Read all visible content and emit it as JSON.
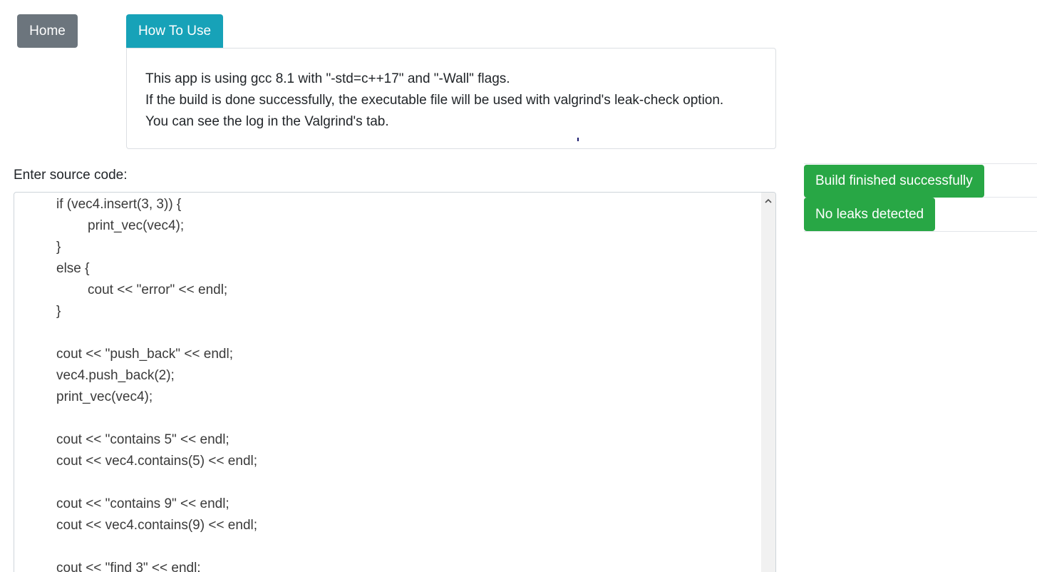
{
  "nav": {
    "home_label": "Home",
    "how_to_use_label": "How To Use"
  },
  "info": {
    "lines": [
      "This app is using gcc 8.1 with \"-std=c++17\" and \"-Wall\" flags.",
      "If the build is done successfully, the executable file will be used with valgrind's leak-check option.",
      "You can see the log in the Valgrind's tab."
    ]
  },
  "editor": {
    "label": "Enter source code:",
    "lines": [
      "if (vec4.insert(3, 3)) {",
      "print_vec(vec4);",
      "}",
      "else {",
      "cout << \"error\" << endl;",
      "}",
      "",
      "cout << \"push_back\" << endl;",
      "vec4.push_back(2);",
      "print_vec(vec4);",
      "",
      "cout << \"contains 5\" << endl;",
      "cout << vec4.contains(5) << endl;",
      "",
      "cout << \"contains 9\" << endl;",
      "cout << vec4.contains(9) << endl;",
      "",
      "cout << \"find 3\" << endl;"
    ]
  },
  "status": {
    "build": "Build finished successfully",
    "leaks": "No leaks detected"
  },
  "colors": {
    "home_button": "#6c757d",
    "how_to_use_button": "#17a2b8",
    "success_badge": "#28a745"
  },
  "icons": {
    "scroll_up": "chevron-up-icon"
  }
}
